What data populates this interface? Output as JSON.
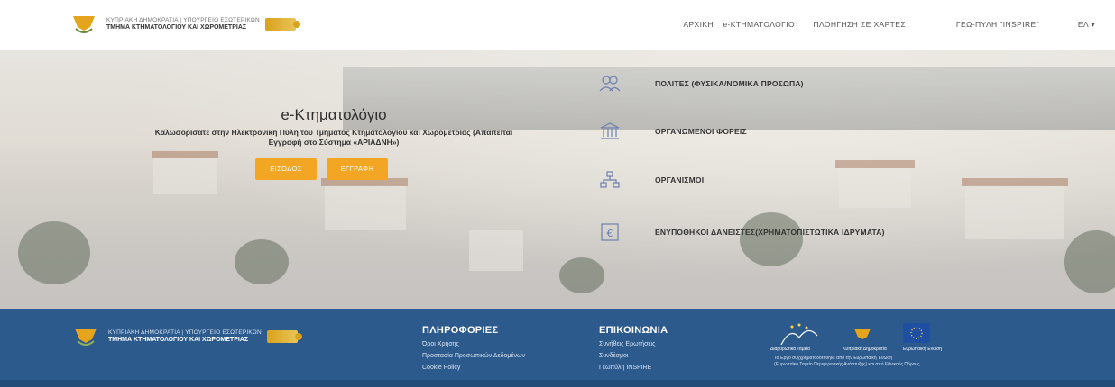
{
  "header": {
    "brand_line1": "ΚΥΠΡΙΑΚΗ ΔΗΜΟΚΡΑΤΙΑ | ΥΠΟΥΡΓΕΙΟ ΕΣΩΤΕΡΙΚΩΝ",
    "brand_line2": "ΤΜΗΜΑ ΚΤΗΜΑΤΟΛΟΓΙΟΥ ΚΑΙ ΧΩΡΟΜΕΤΡΙΑΣ",
    "nav": {
      "home": "ΑΡΧΙΚΗ",
      "ektimatologio": "e-ΚΤΗΜΑΤΟΛΟΓΙΟ",
      "maps": "ΠΛΟΗΓΗΣΗ ΣΕ ΧΑΡΤΕΣ",
      "inspire": "ΓΕΩ-ΠΥΛΗ \"INSPIRE\"",
      "language": "ΕΛ ▾"
    }
  },
  "hero": {
    "title": "e-Κτηματολόγιο",
    "subtitle": "Καλωσορίσατε στην Ηλεκτρονική Πύλη του Τμήματος Κτηματολογίου και Χωρομετρίας (Απαιτείται Εγγραφή στο Σύστημα «ΑΡΙΑΔΝΗ»)",
    "login_label": "ΕΙΣΟΔΟΣ",
    "register_label": "ΕΓΓΡΑΦΗ"
  },
  "categories": [
    {
      "label": "ΠΟΛΙΤΕΣ (ΦΥΣΙΚΑ/ΝΟΜΙΚΑ ΠΡΟΣΩΠΑ)",
      "icon": "users-icon"
    },
    {
      "label": "ΟΡΓΑΝΩΜΕΝΟΙ ΦΟΡΕΙΣ",
      "icon": "institution-icon"
    },
    {
      "label": "ΟΡΓΑΝΙΣΜΟΙ",
      "icon": "organization-icon"
    },
    {
      "label": "ΕΝΥΠΟΘΗΚΟΙ ΔΑΝΕΙΣΤΕΣ(ΧΡΗΜΑΤΟΠΙΣΤΩΤΙΚΑ ΙΔΡΥΜΑΤΑ)",
      "icon": "euro-icon"
    }
  ],
  "footer": {
    "brand_line1": "ΚΥΠΡΙΑΚΗ ΔΗΜΟΚΡΑΤΙΑ | ΥΠΟΥΡΓΕΙΟ ΕΣΩΤΕΡΙΚΩΝ",
    "brand_line2": "ΤΜΗΜΑ ΚΤΗΜΑΤΟΛΟΓΙΟΥ ΚΑΙ ΧΩΡΟΜΕΤΡΙΑΣ",
    "info_title": "ΠΛΗΡΟΦΟΡΙΕΣ",
    "info_links": [
      "Όροι Χρήσης",
      "Προστασία Προσωπικών Δεδομένων",
      "Cookie Policy"
    ],
    "contact_title": "ΕΠΙΚΟΙΝΩΝΙΑ",
    "contact_links": [
      "Συνήθεις Ερωτήσεις",
      "Συνδέσμοι",
      "Γεωπύλη INSPIRE"
    ],
    "fund1": "Διαρθρωτικά Ταμεία",
    "fund2": "Κυπριακή Δημοκρατία",
    "fund3": "Ευρωπαϊκή Ένωση",
    "funds_text_1": "Το Έργο συγχρηματοδοτήθηκε από την Ευρωπαϊκή Ένωση",
    "funds_text_2": "(Ευρωπαϊκό Ταμείο Περιφερειακής Ανάπτυξης) και από Εθνικούς Πόρους"
  },
  "colors": {
    "accent": "#f3a524",
    "footer_bg": "#2c5a8c",
    "icon": "#6d7fae"
  }
}
